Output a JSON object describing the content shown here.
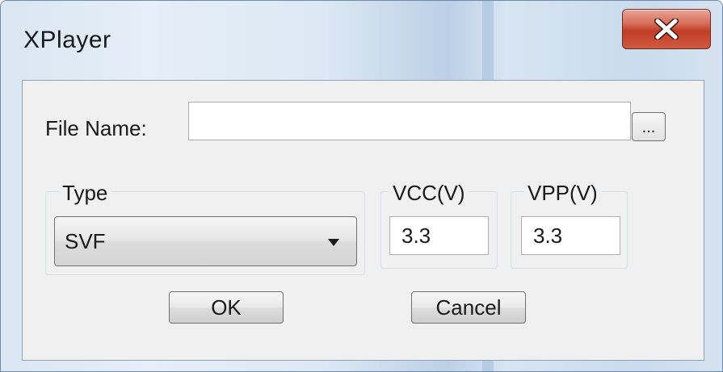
{
  "window": {
    "title": "XPlayer",
    "close_glyph": "✕"
  },
  "file": {
    "label": "File Name:",
    "value": "",
    "browse_label": "..."
  },
  "type": {
    "group_label": "Type",
    "selected": "SVF"
  },
  "vcc": {
    "label": "VCC(V)",
    "value": "3.3"
  },
  "vpp": {
    "label": "VPP(V)",
    "value": "3.3"
  },
  "buttons": {
    "ok": "OK",
    "cancel": "Cancel"
  },
  "colors": {
    "close_button": "#c13d25",
    "dialog_background": "#f0f0f0",
    "frame": "#dce8f4"
  },
  "icons": {
    "close": "close-icon",
    "dropdown": "chevron-down-icon"
  }
}
